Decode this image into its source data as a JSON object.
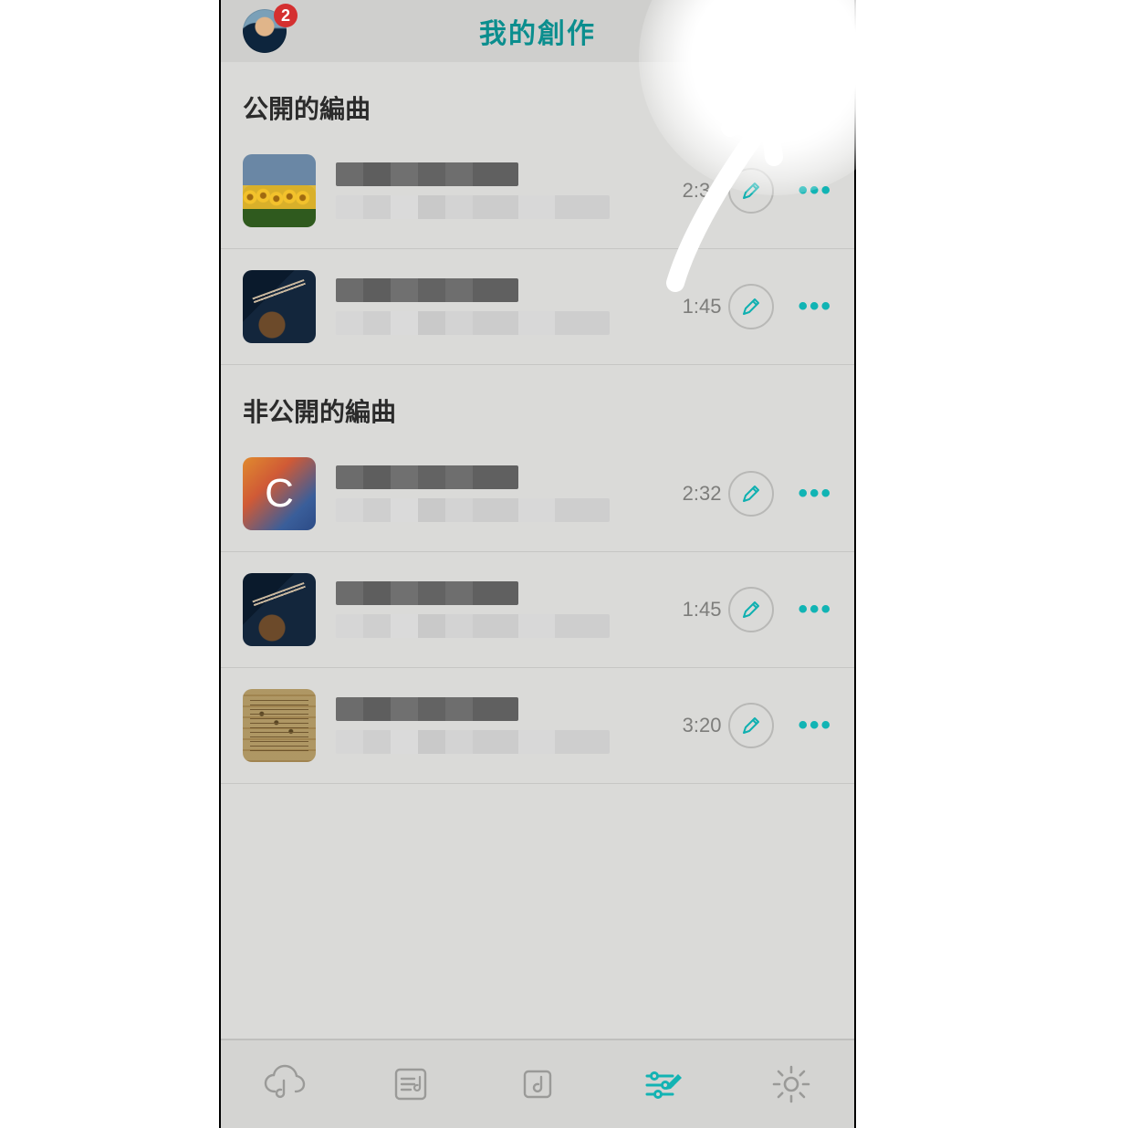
{
  "header": {
    "title": "我的創作",
    "badge_count": "2"
  },
  "sections": {
    "public": {
      "header": "公開的編曲"
    },
    "private": {
      "header": "非公開的編曲"
    }
  },
  "items": [
    {
      "duration": "2:32"
    },
    {
      "duration": "1:45"
    },
    {
      "duration": "2:32",
      "thumb_text": "C"
    },
    {
      "duration": "1:45"
    },
    {
      "duration": "3:20"
    }
  ],
  "icons": {
    "more": "•••"
  }
}
